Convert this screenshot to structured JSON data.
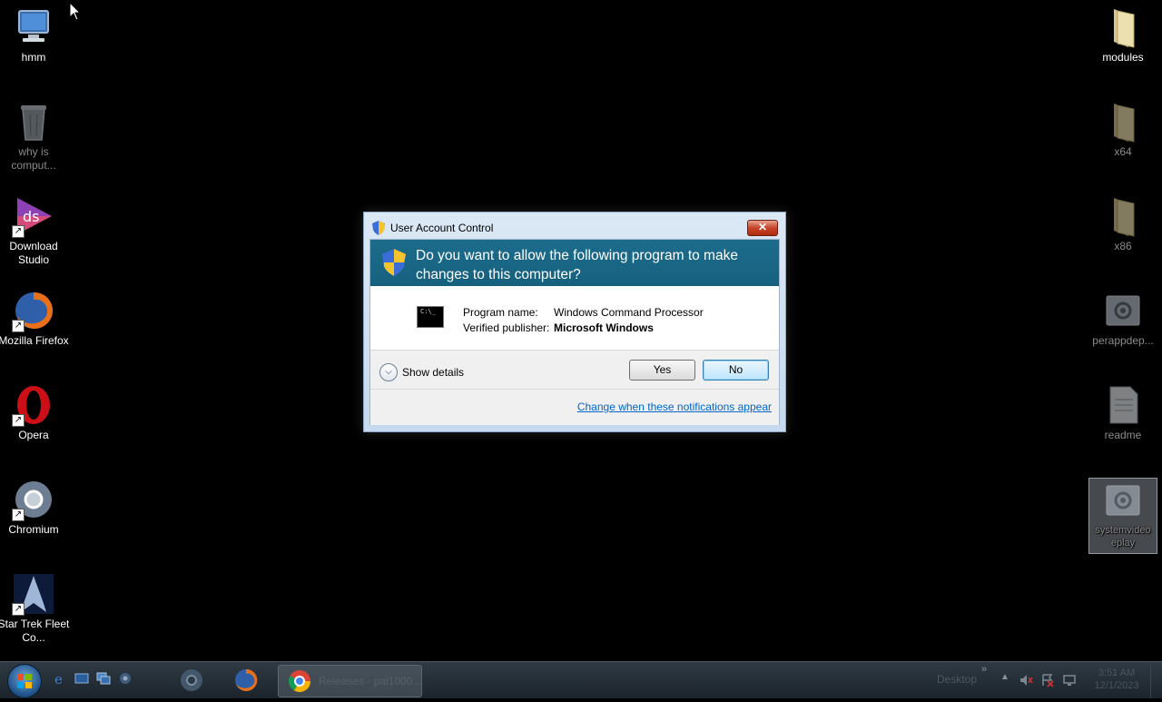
{
  "desktop": {
    "left_icons": [
      {
        "label": "hmm",
        "icon": "computer-icon"
      },
      {
        "label": "why is comput...",
        "icon": "recycle-bin-icon"
      },
      {
        "label": "Download Studio",
        "icon": "download-studio-icon"
      },
      {
        "label": "Mozilla Firefox",
        "icon": "firefox-icon"
      },
      {
        "label": "Opera",
        "icon": "opera-icon"
      },
      {
        "label": "Chromium",
        "icon": "chromium-icon"
      },
      {
        "label": "Star Trek Fleet Co...",
        "icon": "star-trek-icon"
      }
    ],
    "right_icons": [
      {
        "label": "modules",
        "icon": "folder-icon"
      },
      {
        "label": "x64",
        "icon": "folder-icon"
      },
      {
        "label": "x86",
        "icon": "folder-icon"
      },
      {
        "label": "perappdep...",
        "icon": "config-file-icon"
      },
      {
        "label": "readme",
        "icon": "text-file-icon"
      },
      {
        "label": "systemvideo eplay",
        "icon": "config-file-icon"
      }
    ]
  },
  "uac": {
    "title": "User Account Control",
    "close_label": "✕",
    "question": "Do you want to allow the following program to make changes to this computer?",
    "program_name_key": "Program name:",
    "program_name_value": "Windows Command Processor",
    "publisher_key": "Verified publisher:",
    "publisher_value": "Microsoft Windows",
    "cmd_icon_text": "C:\\_",
    "details_label": "Show details",
    "yes_label": "Yes",
    "no_label": "No",
    "link_label": "Change when these notifications appear",
    "colors": {
      "header": "#1d6c8c",
      "link": "#0066cc"
    }
  },
  "taskbar": {
    "active_window_label": "Releases · pal1000...",
    "desktop_toolbar_label": "Desktop",
    "overflow_label": "»",
    "tray_up_label": "▲",
    "clock_time": "3:51 AM",
    "clock_date": "12/1/2023"
  }
}
